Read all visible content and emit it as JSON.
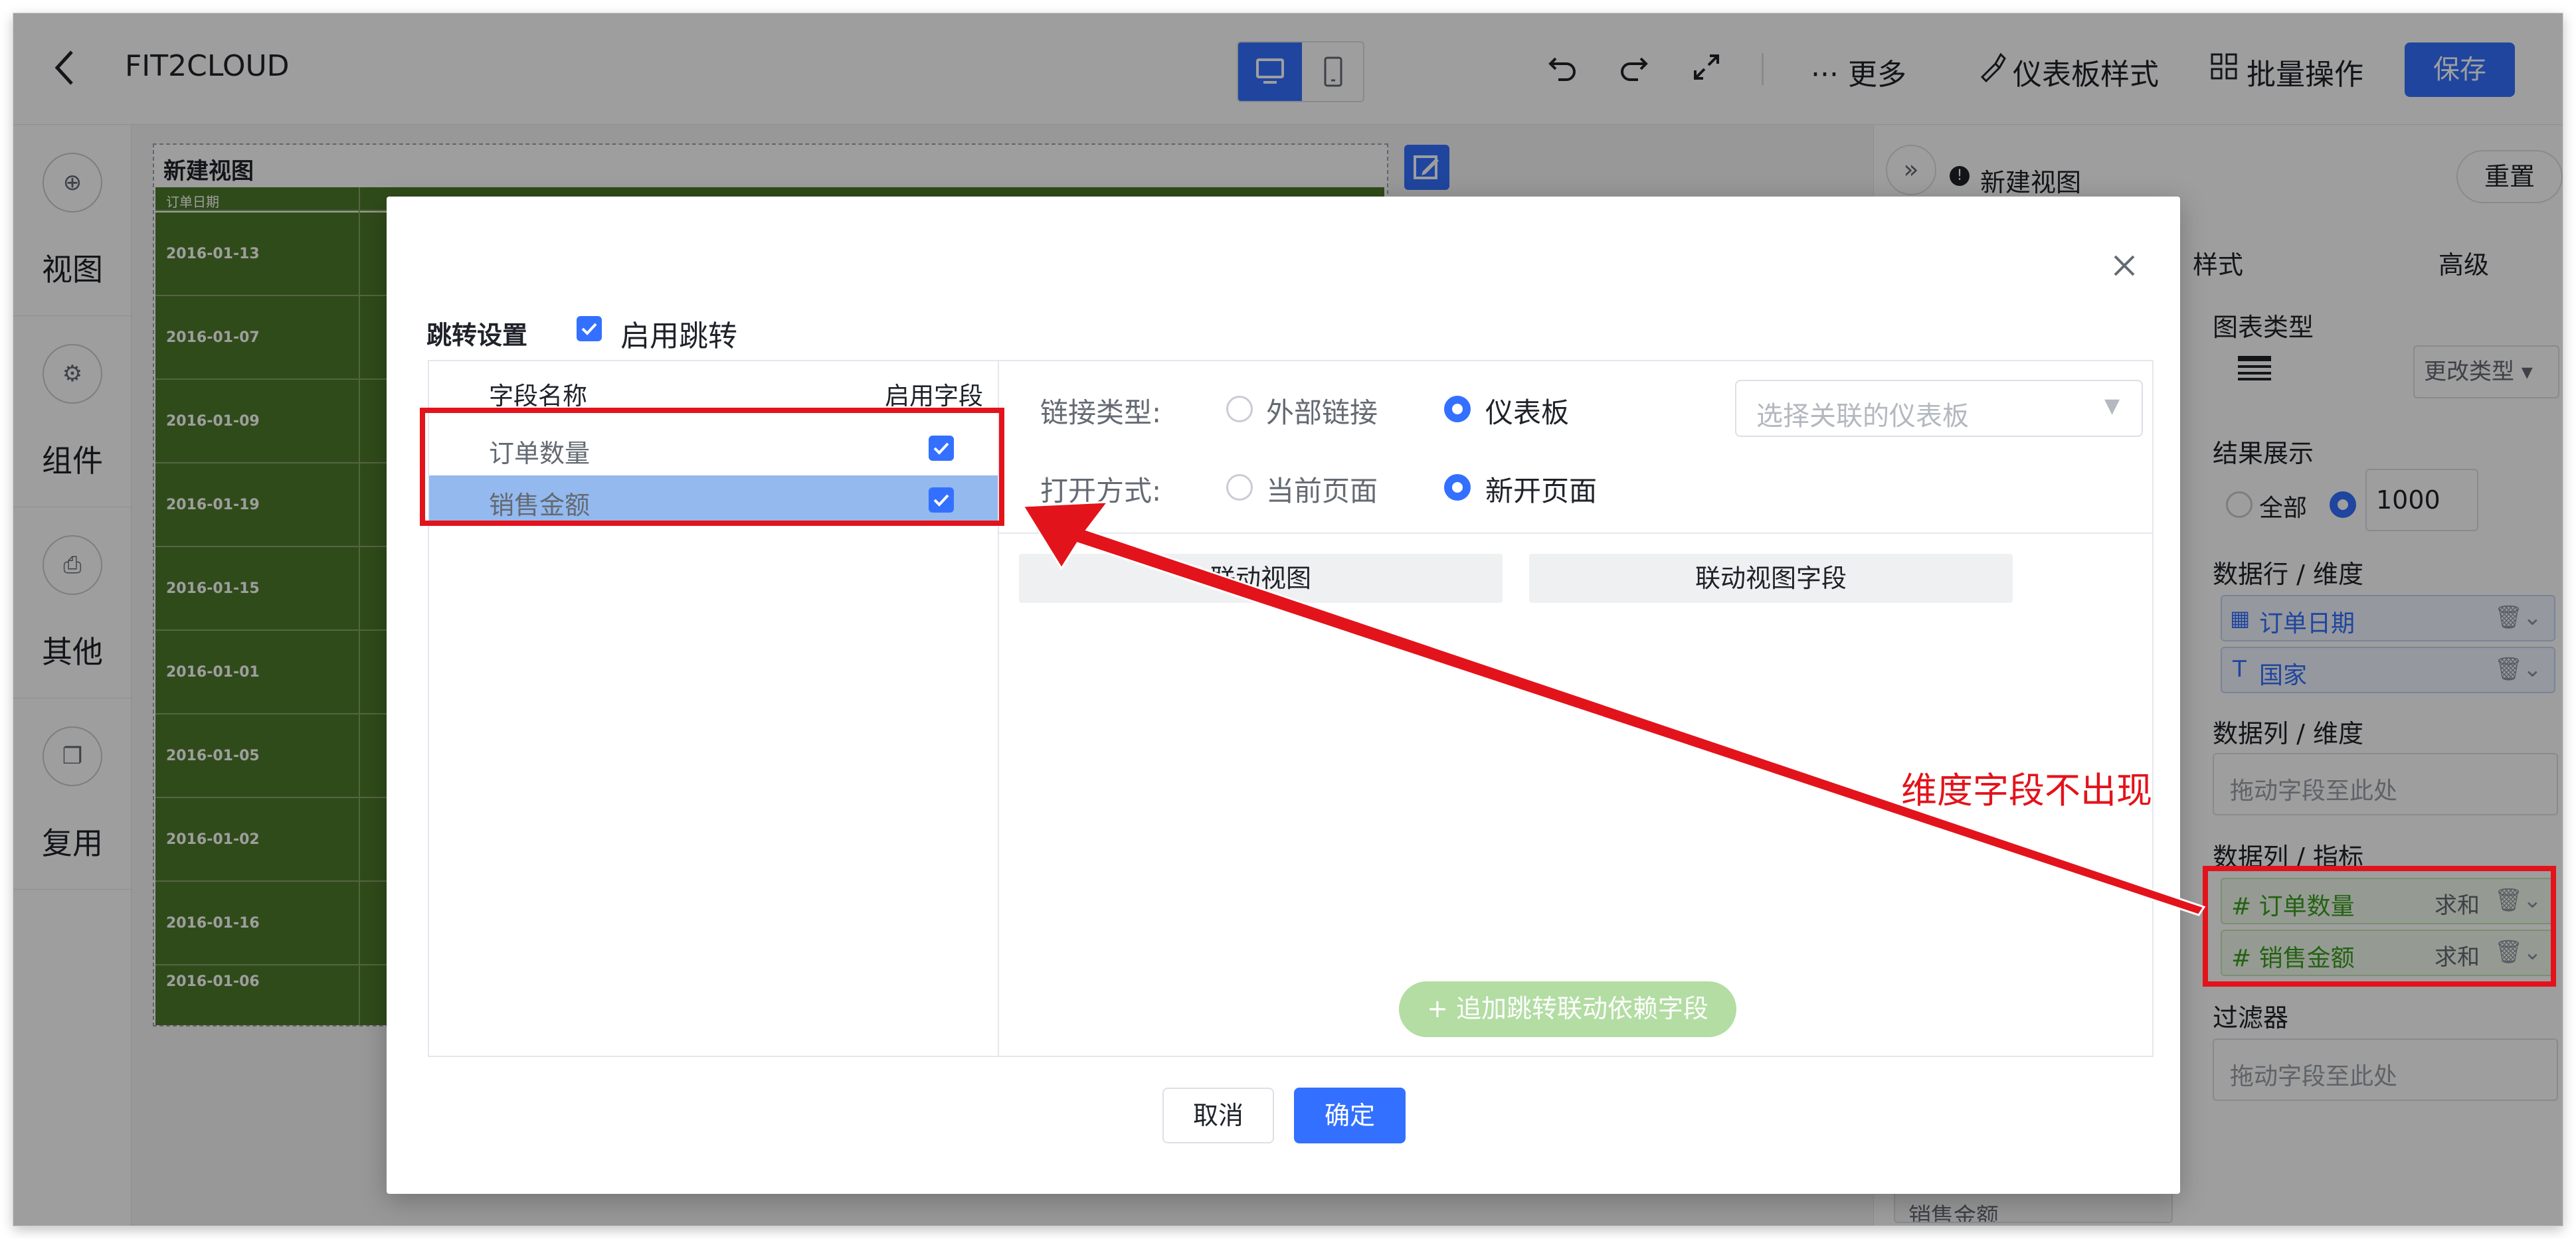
{
  "header": {
    "title": "FIT2CLOUD",
    "more_label": "··· 更多",
    "dashboard_style_label": "仪表板样式",
    "batch_label": "批量操作",
    "save_label": "保存"
  },
  "sidebar": {
    "items": [
      {
        "label": "视图",
        "icon": "plus-circle-icon"
      },
      {
        "label": "组件",
        "icon": "gear-icon"
      },
      {
        "label": "其他",
        "icon": "print-icon"
      },
      {
        "label": "复用",
        "icon": "copy-icon"
      }
    ]
  },
  "view": {
    "title": "新建视图",
    "column_header": "订单日期",
    "rows": [
      "2016-01-13",
      "2016-01-07",
      "2016-01-09",
      "2016-01-19",
      "2016-01-15",
      "2016-01-01",
      "2016-01-05",
      "2016-01-02",
      "2016-01-16",
      "2016-01-06"
    ]
  },
  "right_panel": {
    "view_name": "新建视图",
    "reset_label": "重置",
    "tab_style": "样式",
    "tab_advanced": "高级",
    "chart_type_label": "图表类型",
    "change_type_label": "更改类型",
    "result_label": "结果展示",
    "result_all": "全部",
    "result_count": "1000",
    "rows_dimension_label": "数据行 / 维度",
    "dimension_fields": [
      "订单日期",
      "国家"
    ],
    "cols_dimension_label": "数据列 / 维度",
    "drop_placeholder": "拖动字段至此处",
    "cols_measure_label": "数据列 / 指标",
    "measure_fields": [
      {
        "name": "订单数量",
        "agg": "求和"
      },
      {
        "name": "销售金额",
        "agg": "求和"
      }
    ],
    "filter_label": "过滤器",
    "bottom_field": "销售金额"
  },
  "dialog": {
    "section_label": "跳转设置",
    "enable_jump_label": "启用跳转",
    "col_field_name": "字段名称",
    "col_enable_field": "启用字段",
    "fields": [
      {
        "name": "订单数量",
        "enabled": true,
        "selected": false
      },
      {
        "name": "销售金额",
        "enabled": true,
        "selected": true
      }
    ],
    "link_type_label": "链接类型:",
    "link_type_options": [
      "外部链接",
      "仪表板"
    ],
    "link_type_selected": "仪表板",
    "dashboard_select_placeholder": "选择关联的仪表板",
    "open_mode_label": "打开方式:",
    "open_mode_options": [
      "当前页面",
      "新开页面"
    ],
    "open_mode_selected": "新开页面",
    "linked_view_header": "联动视图",
    "linked_field_header": "联动视图字段",
    "add_dependency_label": "+ 追加跳转联动依赖字段",
    "cancel_label": "取消",
    "confirm_label": "确定"
  },
  "annotation": {
    "text": "维度字段不出现",
    "color": "#e3131b"
  },
  "colors": {
    "accent": "#3370ff",
    "table_green": "#4e7a2a",
    "selected_row": "#93b9ee"
  }
}
